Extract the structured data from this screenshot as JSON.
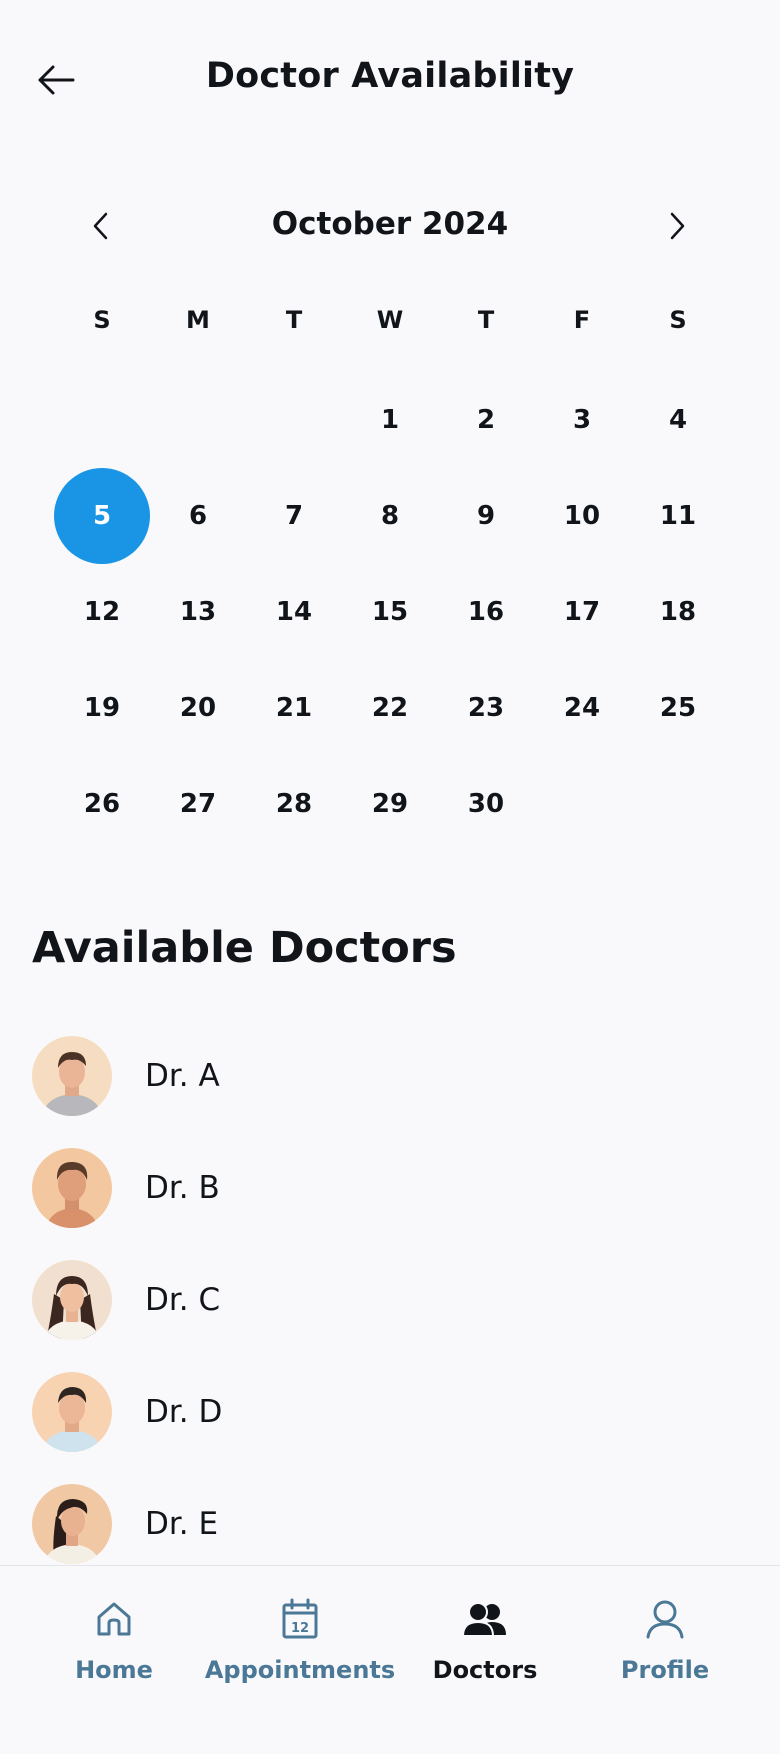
{
  "header": {
    "title": "Doctor Availability",
    "back_icon": "arrow-left-icon"
  },
  "calendar": {
    "month_label": "October 2024",
    "prev_icon": "chevron-left-icon",
    "next_icon": "chevron-right-icon",
    "weekdays": [
      "S",
      "M",
      "T",
      "W",
      "T",
      "F",
      "S"
    ],
    "leading_blank_days": 3,
    "days": [
      "1",
      "2",
      "3",
      "4",
      "5",
      "6",
      "7",
      "8",
      "9",
      "10",
      "11",
      "12",
      "13",
      "14",
      "15",
      "16",
      "17",
      "18",
      "19",
      "20",
      "21",
      "22",
      "23",
      "24",
      "25",
      "26",
      "27",
      "28",
      "29",
      "30"
    ],
    "selected_day": "5",
    "selected_color": "#1a95e6"
  },
  "doctors": {
    "title": "Available Doctors",
    "items": [
      {
        "name": "Dr. A",
        "avatar": "male-avatar"
      },
      {
        "name": "Dr. B",
        "avatar": "male-avatar"
      },
      {
        "name": "Dr. C",
        "avatar": "female-avatar"
      },
      {
        "name": "Dr. D",
        "avatar": "male-avatar"
      },
      {
        "name": "Dr. E",
        "avatar": "female-avatar"
      }
    ]
  },
  "bottom_nav": {
    "items": [
      {
        "label": "Home",
        "icon": "home-icon",
        "active": false
      },
      {
        "label": "Appointments",
        "icon": "calendar-icon",
        "active": false
      },
      {
        "label": "Doctors",
        "icon": "doctors-icon",
        "active": true
      },
      {
        "label": "Profile",
        "icon": "profile-icon",
        "active": false
      }
    ],
    "active_color": "#111418",
    "inactive_color": "#4b7896"
  }
}
